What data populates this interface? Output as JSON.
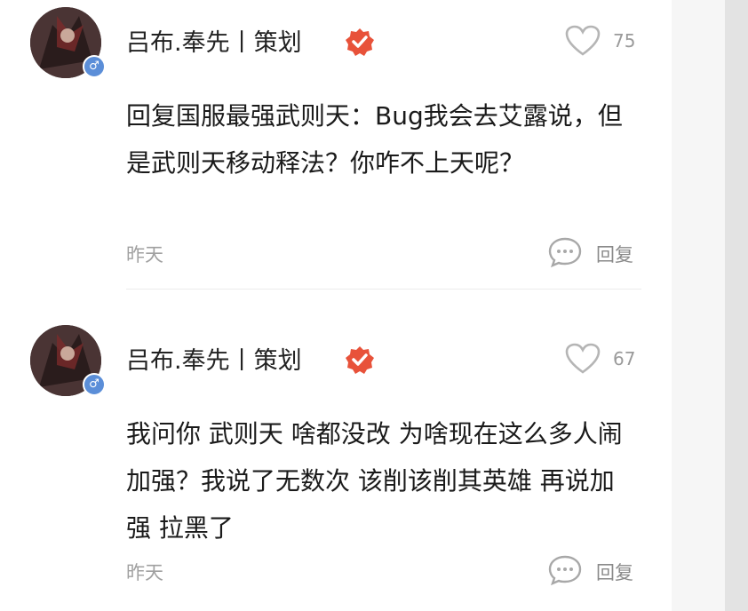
{
  "comments": [
    {
      "username": "吕布.奉先丨策划",
      "gender": "♂",
      "likes": "75",
      "text": "回复国服最强武则天：Bug我会去艾露说，但是武则天移动释法？你咋不上天呢？",
      "time": "昨天",
      "reply_label": "回复"
    },
    {
      "username": "吕布.奉先丨策划",
      "gender": "♂",
      "likes": "67",
      "text": "我问你 武则天 啥都没改 为啥现在这么多人闹加强？我说了无数次 该削该削其英雄 再说加强 拉黑了",
      "time": "昨天",
      "reply_label": "回复"
    }
  ],
  "colors": {
    "badge": "#e8523a",
    "gender_badge": "#5b8ed8",
    "text": "#1a1a1a",
    "muted": "#a0a0a0"
  },
  "icons": [
    "verified-badge-icon",
    "heart-icon",
    "comment-bubble-icon",
    "male-gender-icon"
  ]
}
